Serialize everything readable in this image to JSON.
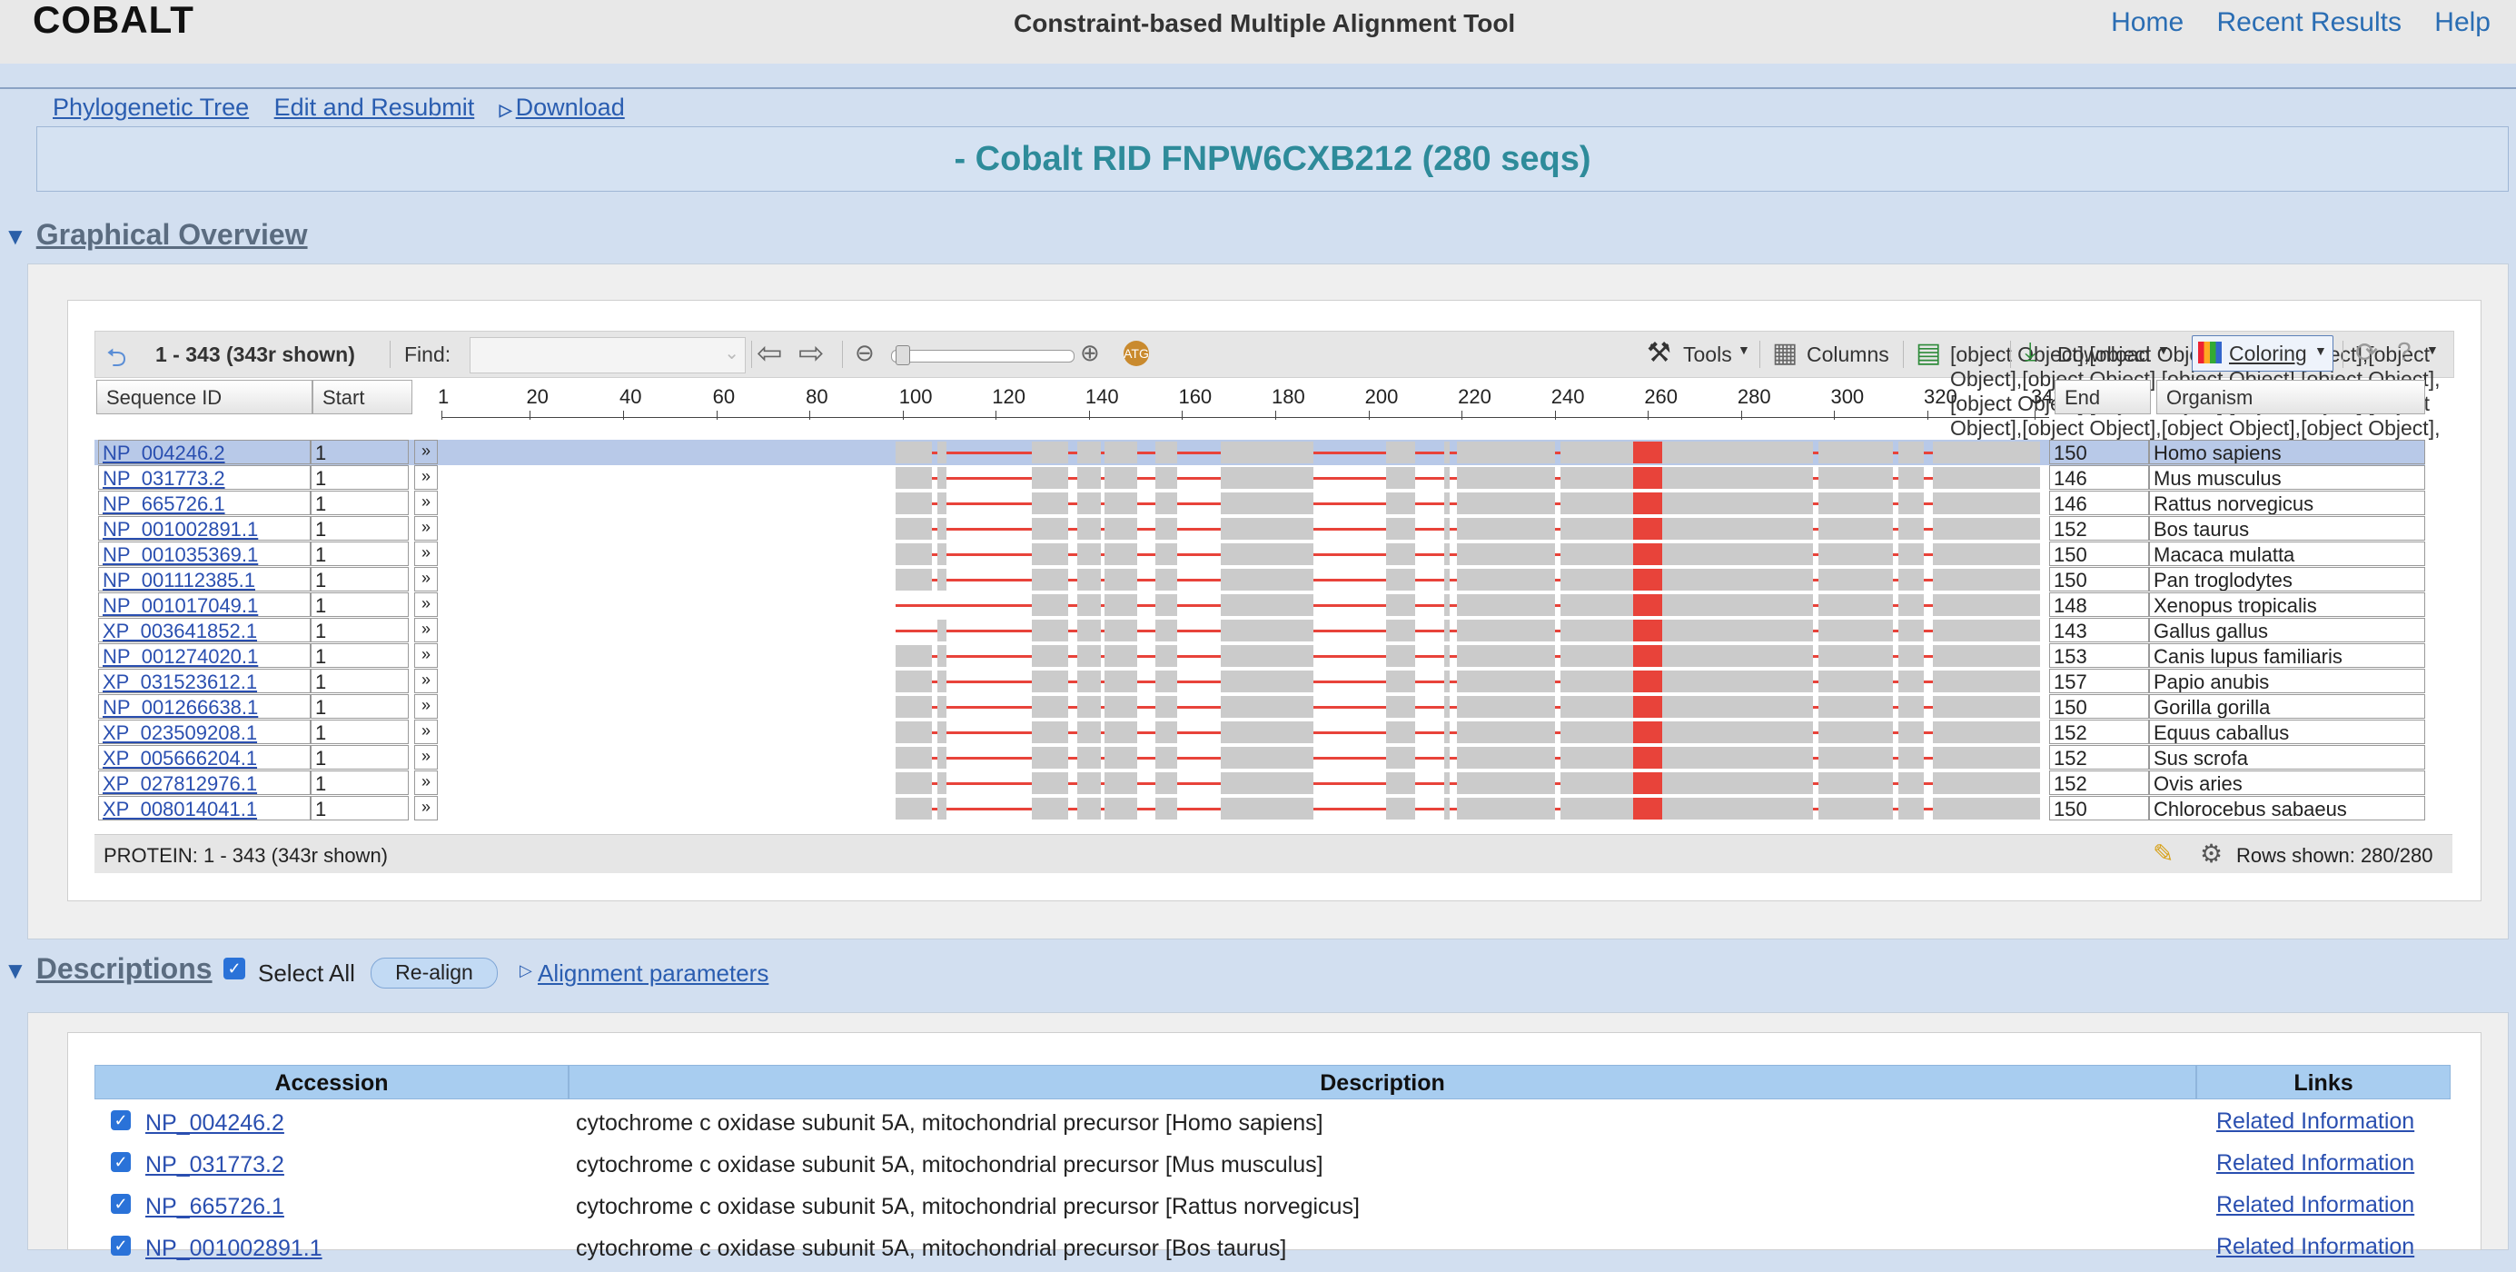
{
  "header": {
    "brand": "COBALT",
    "tool_title": "Constraint-based Multiple Alignment Tool",
    "nav": [
      "Home",
      "Recent Results",
      "Help"
    ]
  },
  "result_links": [
    "Phylogenetic Tree",
    "Edit and Resubmit",
    "Download"
  ],
  "rid_title": "- Cobalt RID FNPW6CXB212 (280 seqs)",
  "graphical": {
    "title": "Graphical Overview",
    "range": "1 - 343 (343r shown)",
    "find_label": "Find:",
    "tools": "Tools",
    "columns": "Columns",
    "rows": [
      {
        "id": "NP_004246.2",
        "start": "1",
        "end": "150",
        "org": "Homo sapiens"
      },
      {
        "id": "NP_031773.2",
        "start": "1",
        "end": "146",
        "org": "Mus musculus"
      },
      {
        "id": "NP_665726.1",
        "start": "1",
        "end": "146",
        "org": "Rattus norvegicus"
      },
      {
        "id": "NP_001002891.1",
        "start": "1",
        "end": "152",
        "org": "Bos taurus"
      },
      {
        "id": "NP_001035369.1",
        "start": "1",
        "end": "150",
        "org": "Macaca mulatta"
      },
      {
        "id": "NP_001112385.1",
        "start": "1",
        "end": "150",
        "org": "Pan troglodytes"
      },
      {
        "id": "NP_001017049.1",
        "start": "1",
        "end": "148",
        "org": "Xenopus tropicalis"
      },
      {
        "id": "XP_003641852.1",
        "start": "1",
        "end": "143",
        "org": "Gallus gallus"
      },
      {
        "id": "NP_001274020.1",
        "start": "1",
        "end": "153",
        "org": "Canis lupus familiaris"
      },
      {
        "id": "XP_031523612.1",
        "start": "1",
        "end": "157",
        "org": "Papio anubis"
      },
      {
        "id": "NP_001266638.1",
        "start": "1",
        "end": "150",
        "org": "Gorilla gorilla"
      },
      {
        "id": "XP_023509208.1",
        "start": "1",
        "end": "152",
        "org": "Equus caballus"
      },
      {
        "id": "XP_005666204.1",
        "start": "1",
        "end": "152",
        "org": "Sus scrofa"
      },
      {
        "id": "XP_027812976.1",
        "start": "1",
        "end": "152",
        "org": "Ovis aries"
      },
      {
        "id": "XP_008014041.1",
        "start": "1",
        "end": "150",
        "org": "Chlorocebus sabaeus"
      }
    ],
    "download": "Download",
    "coloring": "Coloring",
    "col_seqid": "Sequence ID",
    "col_start": "Start",
    "col_end": "End",
    "col_org": "Organism",
    "ruler": [
      "1",
      "20",
      "40",
      "60",
      "80",
      "100",
      "120",
      "140",
      "160",
      "180",
      "200",
      "220",
      "240",
      "260",
      "280",
      "300",
      "320",
      "343"
    ],
    "status_left": "PROTEIN: 1 - 343 (343r shown)",
    "status_right": "Rows shown: 280/280"
  },
  "descriptions": {
    "title": "Descriptions",
    "select_all": "Select All",
    "realign": "Re-align",
    "params": "Alignment parameters",
    "col_accession": "Accession",
    "col_description": "Description",
    "col_links": "Links",
    "rows": [
      {
        "acc": "NP_004246.2",
        "desc": "cytochrome c oxidase subunit 5A, mitochondrial precursor [Homo sapiens]",
        "link": "Related Information"
      },
      {
        "acc": "NP_031773.2",
        "desc": "cytochrome c oxidase subunit 5A, mitochondrial precursor [Mus musculus]",
        "link": "Related Information"
      },
      {
        "acc": "NP_665726.1",
        "desc": "cytochrome c oxidase subunit 5A, mitochondrial precursor [Rattus norvegicus]",
        "link": "Related Information"
      },
      {
        "acc": "NP_001002891.1",
        "desc": "cytochrome c oxidase subunit 5A, mitochondrial precursor [Bos taurus]",
        "link": "Related Information"
      }
    ]
  }
}
